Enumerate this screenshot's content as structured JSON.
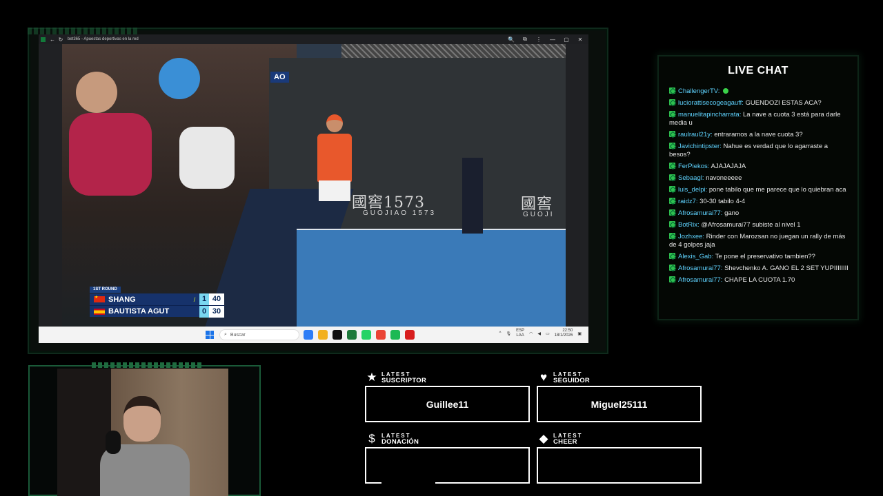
{
  "browser": {
    "title": "bet365 - Apuestas deportivas en la red",
    "back_icon": "←",
    "refresh_icon": "↻",
    "zoom_icon": "🔍",
    "extensions_icon": "⧉",
    "menu_icon": "⋮",
    "minimize_icon": "—",
    "restore_icon": "▢",
    "close_icon": "✕"
  },
  "video": {
    "sponsor_text": "國窖1573",
    "sponsor_sub": "GUOJIAO 1573",
    "sponsor_text2": "國窖",
    "sponsor_sub2": "GUOJI",
    "ao_logo": "AO"
  },
  "scoreboard": {
    "round": "1ST ROUND",
    "players": [
      {
        "name": "SHANG",
        "sets": "1",
        "games": "40",
        "serving": true,
        "serve_mark": "/"
      },
      {
        "name": "BAUTISTA AGUT",
        "sets": "0",
        "games": "30",
        "serving": false,
        "serve_mark": ""
      }
    ]
  },
  "taskbar": {
    "search_placeholder": "Buscar",
    "lang_top": "ESP",
    "lang_bottom": "LAA",
    "time": "22:50",
    "date": "18/1/2026",
    "app_colors": [
      "#2d7df6",
      "#f2b01e",
      "#111111",
      "#1f7a3c",
      "#25d366",
      "#ea4335",
      "#1db954",
      "#d81e1e"
    ]
  },
  "chat": {
    "title": "LIVE CHAT",
    "messages": [
      {
        "user": "ChallengerTV:",
        "text": "",
        "emote": true
      },
      {
        "user": "luciorattisecogeagauff:",
        "text": "GUENDOZI ESTAS ACA?"
      },
      {
        "user": "manuelitapincharrata:",
        "text": "La nave a cuota 3 está para darle media u"
      },
      {
        "user": "raulraul21y:",
        "text": "entraramos a la nave cuota 3?"
      },
      {
        "user": "Javichintipster:",
        "text": "Nahue es verdad que lo agarraste a besos?"
      },
      {
        "user": "FerPiekos:",
        "text": "AJAJAJAJA"
      },
      {
        "user": "Sebaagl:",
        "text": "navoneeeee"
      },
      {
        "user": "luis_delpi:",
        "text": "pone tabilo que me parece que lo quiebran aca"
      },
      {
        "user": "raidz7:",
        "text": "30-30 tabilo 4-4"
      },
      {
        "user": "Afrosamurai77:",
        "text": "gano"
      },
      {
        "user": "BotRix:",
        "text": "@Afrosamurai77 subiste al nivel 1"
      },
      {
        "user": "Jozhxee:",
        "text": "Rinder con Marozsan no juegan un rally de más de 4 golpes jaja"
      },
      {
        "user": "Alexis_Gab:",
        "text": "Te pone el preservativo tambien??"
      },
      {
        "user": "Afrosamurai77:",
        "text": "Shevchenko A. GANO EL 2 SET YUPIIIIIIII"
      },
      {
        "user": "Afrosamurai77:",
        "text": "CHAPE LA CUOTA 1.70"
      }
    ]
  },
  "alerts": {
    "subscriber": {
      "small": "LATEST",
      "big": "SUSCRIPTOR",
      "value": "Guillee11",
      "icon": "★"
    },
    "follower": {
      "small": "LATEST",
      "big": "SEGUIDOR",
      "value": "Miguel25111",
      "icon": "♥"
    },
    "donation": {
      "small": "LATEST",
      "big": "DONACIÓN",
      "value": "",
      "icon": "$"
    },
    "cheer": {
      "small": "LATEST",
      "big": "CHEER",
      "value": "",
      "icon": "◆"
    }
  }
}
